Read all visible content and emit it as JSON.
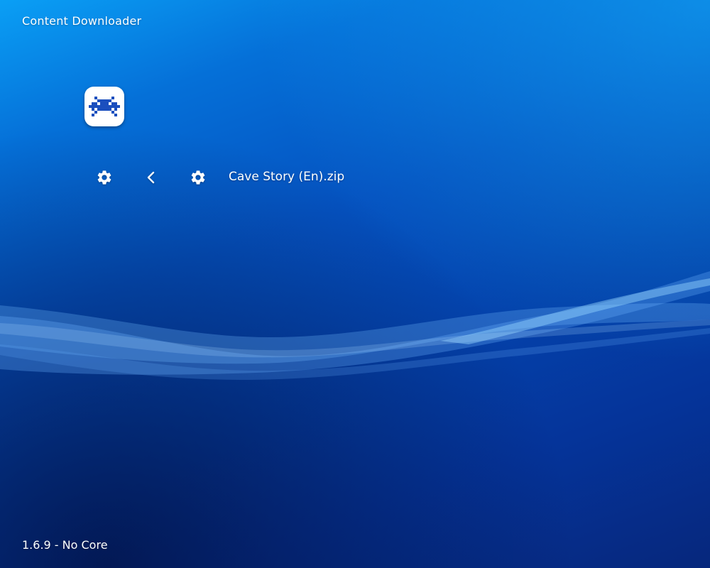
{
  "header": {
    "title": "Content Downloader"
  },
  "logo": {
    "icon": "retroarch-invader-icon"
  },
  "navigation": {
    "left_settings_icon": "gear-icon",
    "back_icon": "chevron-left-icon",
    "item_settings_icon": "gear-icon",
    "selected_item_label": "Cave Story (En).zip"
  },
  "footer": {
    "version_text": "1.6.9 - No Core"
  },
  "colors": {
    "background_top_right": "#0a9ff5",
    "background_mid": "#0552c0",
    "background_bottom_left": "#06277c",
    "logo_background": "#ffffff",
    "logo_glyph": "#1b4fbe",
    "text": "#ffffff"
  }
}
